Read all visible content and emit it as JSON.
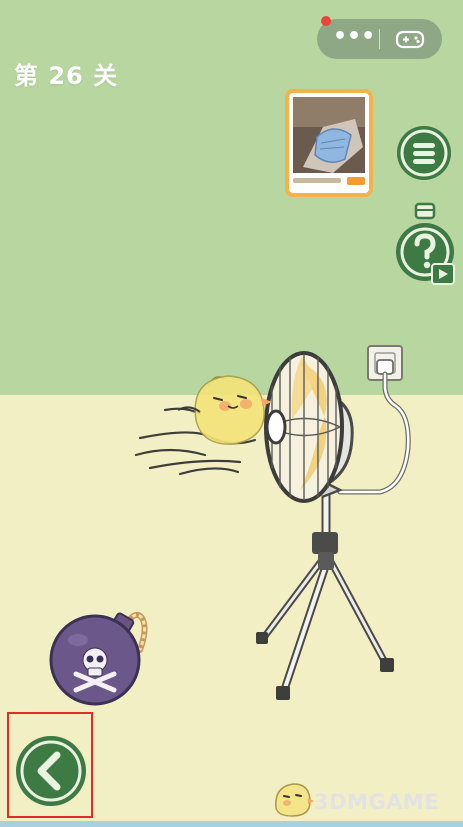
{
  "level": {
    "title": "第 26 关"
  },
  "capsule": {
    "more_glyph": "•••",
    "more_icon": "more-dots-icon",
    "game_icon": "gamepad-icon"
  },
  "ad": {
    "icon": "video-ad-thumbnail"
  },
  "buttons": {
    "menu_icon": "menu-icon",
    "hint_icon": "lightbulb-question-icon",
    "hint_badge_icon": "video-play-icon",
    "back_icon": "chevron-left-icon"
  },
  "scene": {
    "objects": [
      "electric-fan-on-tripod",
      "wall-socket-with-plug",
      "yellow-chick-character",
      "bomb-with-skull",
      "wind-lines"
    ]
  },
  "watermark": {
    "text": "3DMGAME"
  },
  "colors": {
    "wall": "#b7d6a0",
    "floor": "#f3efc4",
    "highlight": "#e02b2b",
    "ad_border": "#f5b14a",
    "button_green": "#3e7a44"
  }
}
